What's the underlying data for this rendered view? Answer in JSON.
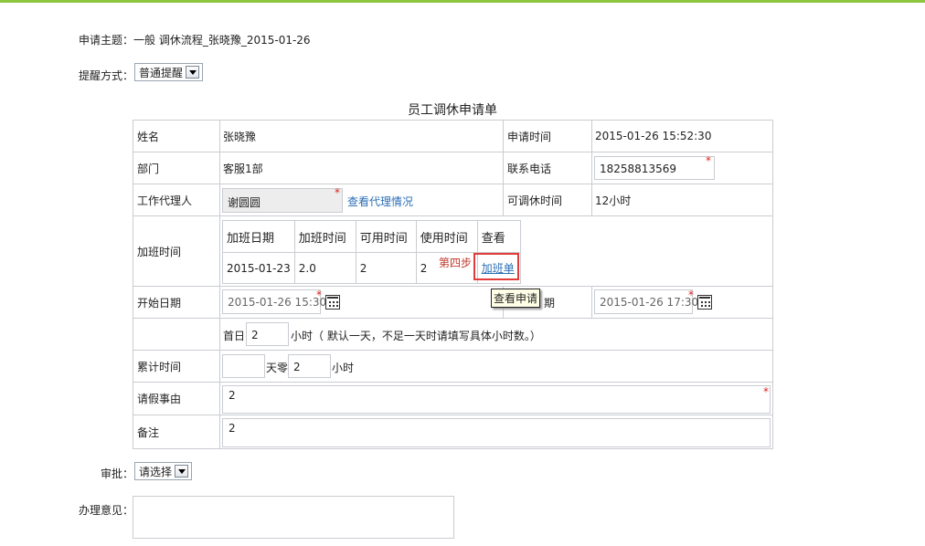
{
  "header": {
    "subject_label": "申请主题：",
    "subject_value": "一般 调休流程_张晓豫_2015-01-26",
    "remind_label": "提醒方式：",
    "remind_value": "普通提醒"
  },
  "form": {
    "title": "员工调休申请单",
    "name_label": "姓名",
    "name_value": "张晓豫",
    "apply_time_label": "申请时间",
    "apply_time_value": "2015-01-26 15:52:30",
    "dept_label": "部门",
    "dept_value": "客服1部",
    "phone_label": "联系电话",
    "phone_value": "18258813569",
    "agent_label": "工作代理人",
    "agent_value": "谢圆圆",
    "agent_link": "查看代理情况",
    "available_label": "可调休时间",
    "available_value": "12小时",
    "overtime_label": "加班时间",
    "overtime_table": {
      "headers": [
        "加班日期",
        "加班时间",
        "可用时间",
        "使用时间",
        "查看"
      ],
      "row": [
        "2015-01-23",
        "2.0",
        "2",
        "2",
        "加班单"
      ]
    },
    "step_note": "第四步",
    "tooltip": "查看申请",
    "start_label": "开始日期",
    "start_value": "2015-01-26 15:30",
    "end_label_partial": "期",
    "end_value": "2015-01-26 17:30",
    "first_day_label": "首日",
    "first_day_value": "2",
    "first_day_hint": "小时（ 默认一天，不足一天时请填写具体小时数。）",
    "total_label": "累计时间",
    "total_days_value": "",
    "days_unit": "天零",
    "total_hours_value": "2",
    "hours_unit": "小时",
    "reason_label": "请假事由",
    "reason_value": "2",
    "remark_label": "备注",
    "remark_value": "2"
  },
  "approval": {
    "label": "审批：",
    "select_value": "请选择",
    "opinion_label": "办理意见："
  },
  "colors": {
    "accent_bar": "#8cc63e",
    "link": "#2a6eb5",
    "required_star": "#d22222",
    "highlight_box": "#e23b3b"
  }
}
